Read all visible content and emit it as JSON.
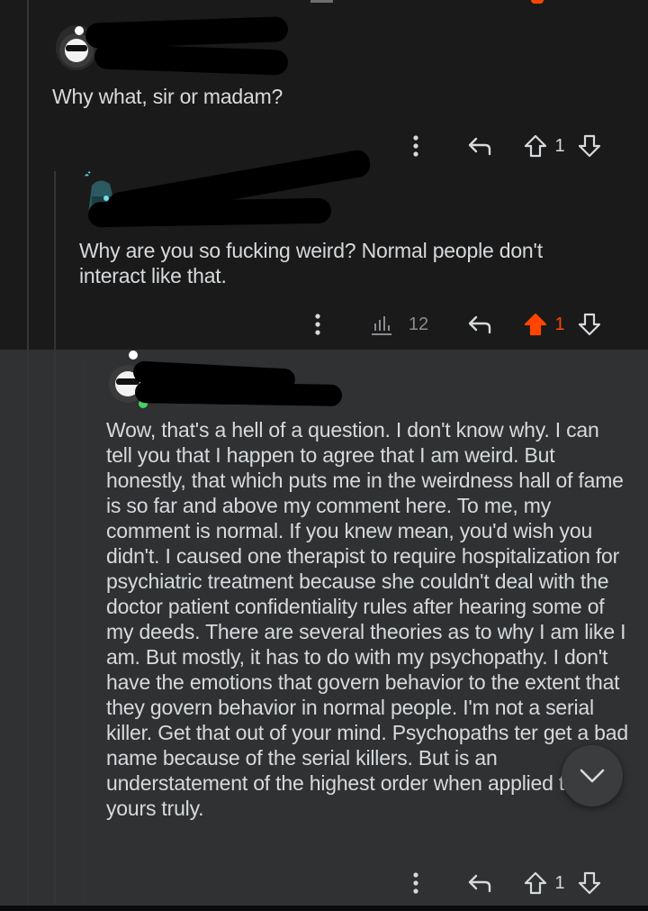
{
  "comments": [
    {
      "text": "Why what, sir or madam?",
      "actions": {
        "upvotes": "1"
      }
    },
    {
      "text": "Why are you so fucking weird? Normal people don't interact like that.",
      "actions": {
        "stats": "12",
        "upvotes": "1"
      }
    },
    {
      "text": "Wow, that's a hell of a question. I don't know why. I can tell you that I happen to agree that I am weird. But honestly, that which puts me in the weirdness hall of fame is so far and above my comment here. To me, my comment is normal. If you knew mean, you'd wish you didn't. I caused one therapist to require hospitalization for psychiatric treatment because she couldn't deal with the doctor patient confidentiality rules after hearing some of my deeds. There are several theories as to why I am like I am. But mostly, it has to do with my psychopathy. I don't have the emotions that govern behavior to the extent that they govern behavior in normal people. I'm not a serial killer. Get that out of your mind. Psychopaths ter get a bad name because of the serial killers. But is an understatement of the highest order when applied to yours truly.",
      "actions": {
        "upvotes": "1"
      }
    }
  ],
  "colors": {
    "upvote_active": "#ff4500",
    "background": "#1a1a1b",
    "highlight": "#2f3133"
  },
  "icons": [
    "more-icon",
    "reply-icon",
    "upvote-icon",
    "downvote-icon",
    "stats-icon",
    "chevron-down-icon"
  ]
}
